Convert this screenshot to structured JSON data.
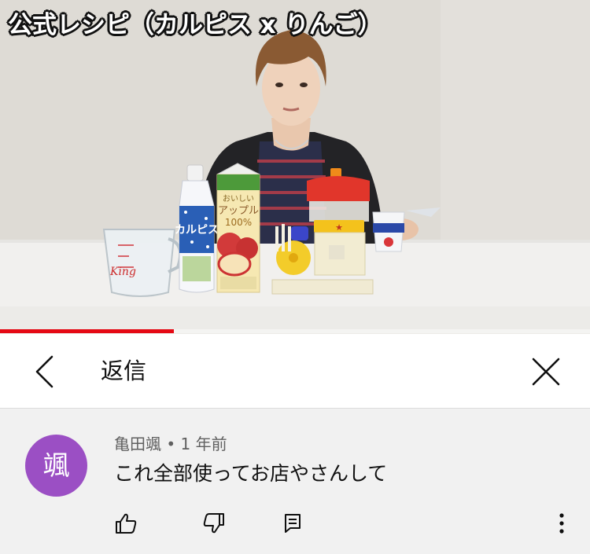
{
  "video": {
    "title_overlay": "公式レシピ（カルピス x りんご）",
    "progress_fraction": 0.295,
    "scene_labels": {
      "calpis_bottle": "カルピス",
      "juice_carton_top": "おいしい",
      "juice_carton_name": "アップル",
      "juice_carton_pct": "100%",
      "machine_sign": "★"
    }
  },
  "reply_header": {
    "title": "返信",
    "back_icon": "chevron-left-icon",
    "close_icon": "close-icon"
  },
  "comment": {
    "avatar_initial": "颯",
    "avatar_color": "#9b4fc4",
    "author": "亀田颯",
    "separator": "•",
    "time": "1 年前",
    "text": "これ全部使ってお店やさんして",
    "actions": {
      "like_icon": "thumbs-up-icon",
      "dislike_icon": "thumbs-down-icon",
      "reply_icon": "reply-icon",
      "more_icon": "more-vertical-icon"
    }
  },
  "colors": {
    "progress": "#e50914",
    "comment_bg": "#f1f1f1",
    "meta_text": "#606060"
  }
}
